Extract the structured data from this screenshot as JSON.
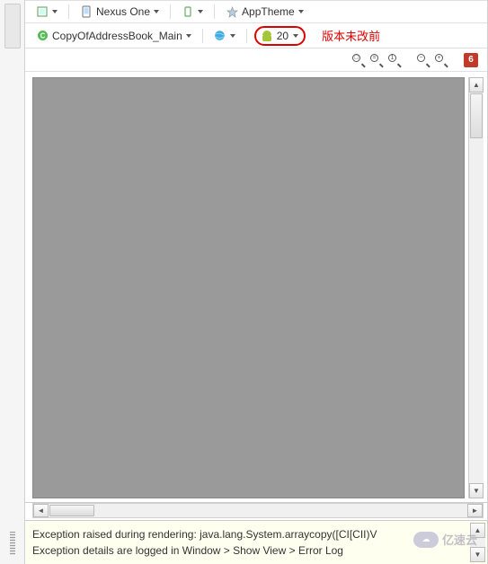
{
  "toolbar1": {
    "device_label": "Nexus One",
    "theme_label": "AppTheme"
  },
  "toolbar2": {
    "activity_label": "CopyOfAddressBook_Main",
    "api_level": "20",
    "annotation": "版本未改前"
  },
  "zoom": {
    "error_count": "6"
  },
  "error_panel": {
    "line1": "Exception raised during rendering: java.lang.System.arraycopy([CI[CII)V",
    "line2": "Exception details are logged in Window > Show View > Error Log"
  },
  "watermark": {
    "text": "亿速云"
  }
}
